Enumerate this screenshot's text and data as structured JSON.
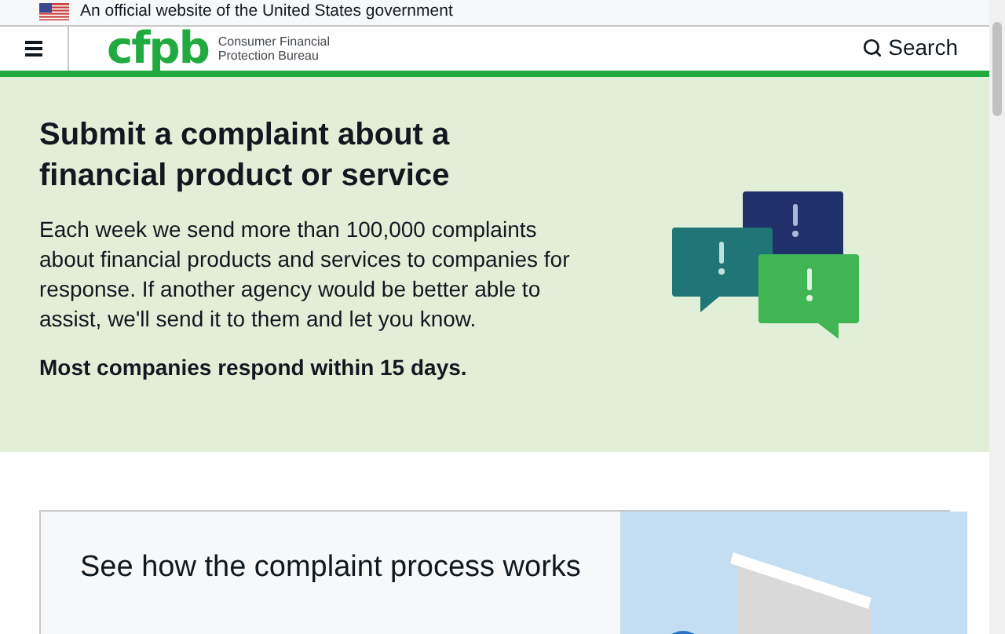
{
  "banner": {
    "text": "An official website of the United States government"
  },
  "header": {
    "logo": "cfpb",
    "logo_subtitle": "Consumer Financial Protection Bureau",
    "search": "Search"
  },
  "hero": {
    "title": "Submit a complaint about a financial product or service",
    "body": "Each week we send more than 100,000 complaints about financial products and services to companies for response. If another agency would be better able to assist, we'll send it to them and let you know.",
    "note": "Most companies respond within 15 days."
  },
  "card": {
    "title": "See how the complaint process works",
    "kind": "picture"
  }
}
